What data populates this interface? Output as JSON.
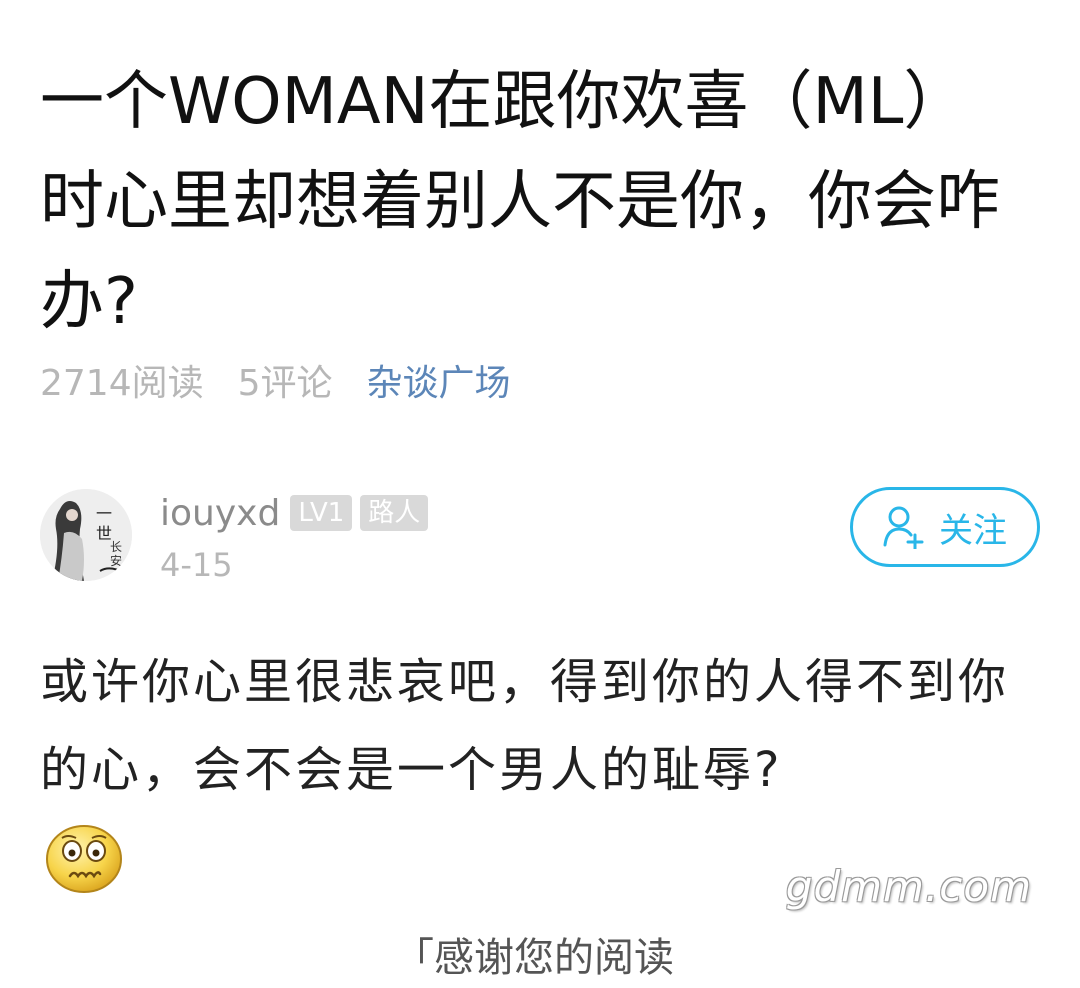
{
  "post": {
    "title": "一个WOMAN在跟你欢喜（ML）时心里却想着别人不是你，你会咋办?",
    "reads": "2714阅读",
    "comments": "5评论",
    "category": "杂谈广场"
  },
  "author": {
    "username": "iouyxd",
    "level_badge": "LV1",
    "rank_badge": "路人",
    "date": "4-15",
    "follow_label": "关注"
  },
  "content": {
    "text": "或许你心里很悲哀吧，得到你的人得不到你的心，会不会是一个男人的耻辱?",
    "emoji": "worried-face-emoji"
  },
  "watermark": "gdmm.com",
  "footer_partial": "「感谢您的阅读",
  "colors": {
    "accent": "#29b6e8",
    "category": "#5c86b8",
    "muted": "#b7b7b7",
    "badge_bg": "#d9d9d9"
  }
}
